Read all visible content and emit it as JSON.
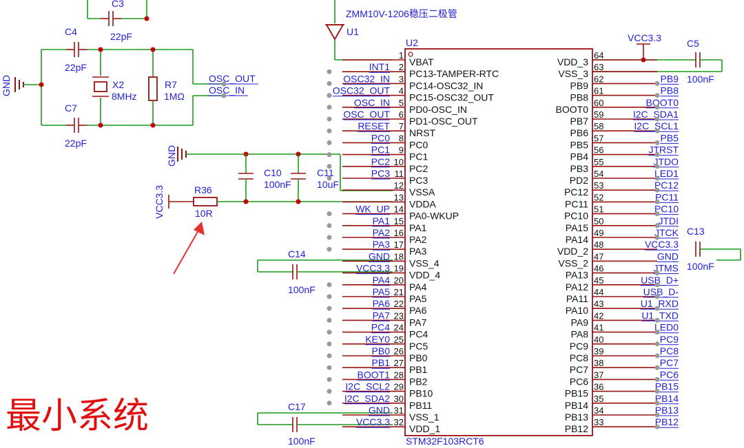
{
  "schematic": {
    "top_text": "ZMM10V-1206稳压二极管",
    "chip": {
      "designator": "U2",
      "part": "STM32F103RCT6",
      "left_pins": [
        {
          "num": "1",
          "name": "VBAT",
          "net": ""
        },
        {
          "num": "2",
          "name": "PC13-TAMPER-RTC",
          "net": "INT1"
        },
        {
          "num": "3",
          "name": "PC14-OSC32_IN",
          "net": "OSC32_IN"
        },
        {
          "num": "4",
          "name": "PC15-OSC32_OUT",
          "net": "OSC32_OUT"
        },
        {
          "num": "5",
          "name": "PD0-OSC_IN",
          "net": "OSC_IN"
        },
        {
          "num": "6",
          "name": "PD1-OSC_OUT",
          "net": "OSC_OUT"
        },
        {
          "num": "7",
          "name": "NRST",
          "net": "RESET"
        },
        {
          "num": "8",
          "name": "PC0",
          "net": "PC0"
        },
        {
          "num": "9",
          "name": "PC1",
          "net": "PC1"
        },
        {
          "num": "10",
          "name": "PC2",
          "net": "PC2"
        },
        {
          "num": "11",
          "name": "PC3",
          "net": "PC3"
        },
        {
          "num": "12",
          "name": "VSSA",
          "net": ""
        },
        {
          "num": "13",
          "name": "VDDA",
          "net": ""
        },
        {
          "num": "14",
          "name": "PA0-WKUP",
          "net": "WK_UP"
        },
        {
          "num": "15",
          "name": "PA1",
          "net": "PA1"
        },
        {
          "num": "16",
          "name": "PA2",
          "net": "PA2"
        },
        {
          "num": "17",
          "name": "PA3",
          "net": "PA3"
        },
        {
          "num": "18",
          "name": "VSS_4",
          "net": "GND"
        },
        {
          "num": "19",
          "name": "VDD_4",
          "net": "VCC3.3"
        },
        {
          "num": "20",
          "name": "PA4",
          "net": "PA4"
        },
        {
          "num": "21",
          "name": "PA5",
          "net": "PA5"
        },
        {
          "num": "22",
          "name": "PA6",
          "net": "PA6"
        },
        {
          "num": "23",
          "name": "PA7",
          "net": "PA7"
        },
        {
          "num": "24",
          "name": "PC4",
          "net": "PC4"
        },
        {
          "num": "25",
          "name": "PC5",
          "net": "KEY0"
        },
        {
          "num": "26",
          "name": "PB0",
          "net": "PB0"
        },
        {
          "num": "27",
          "name": "PB1",
          "net": "PB1"
        },
        {
          "num": "28",
          "name": "PB2",
          "net": "BOOT1"
        },
        {
          "num": "29",
          "name": "PB10",
          "net": "I2C_SCL2"
        },
        {
          "num": "30",
          "name": "PB11",
          "net": "I2C_SDA2"
        },
        {
          "num": "31",
          "name": "VSS_1",
          "net": "GND"
        },
        {
          "num": "32",
          "name": "VDD_1",
          "net": "VCC3.3"
        }
      ],
      "right_pins": [
        {
          "num": "64",
          "name": "VDD_3",
          "net": ""
        },
        {
          "num": "63",
          "name": "VSS_3",
          "net": ""
        },
        {
          "num": "62",
          "name": "PB9",
          "net": "PB9"
        },
        {
          "num": "61",
          "name": "PB8",
          "net": "PB8"
        },
        {
          "num": "60",
          "name": "BOOT0",
          "net": "BOOT0"
        },
        {
          "num": "59",
          "name": "PB7",
          "net": "I2C_SDA1"
        },
        {
          "num": "58",
          "name": "PB6",
          "net": "I2C_SCL1"
        },
        {
          "num": "57",
          "name": "PB5",
          "net": "PB5"
        },
        {
          "num": "56",
          "name": "PB4",
          "net": "JTRST"
        },
        {
          "num": "55",
          "name": "PB3",
          "net": "JTDO"
        },
        {
          "num": "54",
          "name": "PD2",
          "net": "LED1"
        },
        {
          "num": "53",
          "name": "PC12",
          "net": "PC12"
        },
        {
          "num": "52",
          "name": "PC11",
          "net": "PC11"
        },
        {
          "num": "51",
          "name": "PC10",
          "net": "PC10"
        },
        {
          "num": "50",
          "name": "PA15",
          "net": "JTDI"
        },
        {
          "num": "49",
          "name": "PA14",
          "net": "JTCK"
        },
        {
          "num": "48",
          "name": "VDD_2",
          "net": "VCC3.3"
        },
        {
          "num": "47",
          "name": "VSS_2",
          "net": "GND"
        },
        {
          "num": "46",
          "name": "PA13",
          "net": "JTMS"
        },
        {
          "num": "45",
          "name": "PA12",
          "net": "USB_D+"
        },
        {
          "num": "44",
          "name": "PA11",
          "net": "USB_D-"
        },
        {
          "num": "43",
          "name": "PA10",
          "net": "U1_RXD"
        },
        {
          "num": "42",
          "name": "PA9",
          "net": "U1_TXD"
        },
        {
          "num": "41",
          "name": "PA8",
          "net": "LED0"
        },
        {
          "num": "40",
          "name": "PC9",
          "net": "PC9"
        },
        {
          "num": "39",
          "name": "PC8",
          "net": "PC8"
        },
        {
          "num": "38",
          "name": "PC7",
          "net": "PC7"
        },
        {
          "num": "37",
          "name": "PC6",
          "net": "PC6"
        },
        {
          "num": "36",
          "name": "PB15",
          "net": "PB15"
        },
        {
          "num": "35",
          "name": "PB14",
          "net": "PB14"
        },
        {
          "num": "34",
          "name": "PB13",
          "net": "PB13"
        },
        {
          "num": "33",
          "name": "PB12",
          "net": "PB12"
        }
      ]
    },
    "parts": {
      "c3": {
        "ref": "C3",
        "val": "22pF"
      },
      "c4": {
        "ref": "C4",
        "val": "22pF"
      },
      "c7": {
        "ref": "C7",
        "val": "22pF"
      },
      "x2": {
        "ref": "X2",
        "val": "8MHz"
      },
      "r7": {
        "ref": "R7",
        "val": "1MΩ"
      },
      "u1": {
        "ref": "U1"
      },
      "c5": {
        "ref": "C5",
        "val": "100nF"
      },
      "c10": {
        "ref": "C10",
        "val": "100nF"
      },
      "c11": {
        "ref": "C11",
        "val": "10uF"
      },
      "r36": {
        "ref": "R36",
        "val": "10R"
      },
      "c13": {
        "ref": "C13",
        "val": "100nF"
      },
      "c14": {
        "ref": "C14",
        "val": "100nF"
      },
      "c17": {
        "ref": "C17",
        "val": "100nF"
      }
    },
    "labels": {
      "osc_out": "OSC_OUT",
      "osc_in": "OSC_IN",
      "gnd": "GND",
      "vcc": "VCC3.3"
    },
    "caption": "最小系统",
    "colors": {
      "wire": "#1a9a1a",
      "part": "#9a1010",
      "net_label": "#1e1ed8",
      "caption": "#e01010"
    }
  }
}
